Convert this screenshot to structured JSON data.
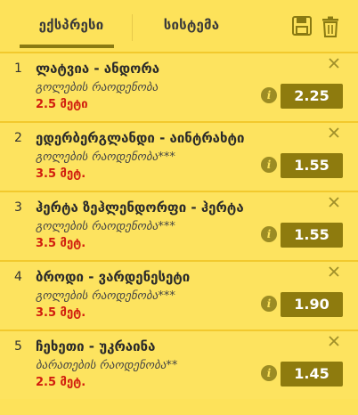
{
  "tabs": {
    "express": "ექსპრესი",
    "system": "სისტემა"
  },
  "icons": {
    "save": "floppy-disk-icon",
    "trash": "trash-icon",
    "close": "close-icon",
    "info": "info-icon"
  },
  "colors": {
    "background": "#fde25a",
    "odds_bg": "#8e7b0e",
    "pick_text": "#d11d0e",
    "tab_underline": "#8a7a12"
  },
  "bets": [
    {
      "num": "1",
      "match": "ლატვია - ანდორა",
      "market": "გოლების რაოდენობა",
      "pick": "2.5 მეტი",
      "odds": "2.25"
    },
    {
      "num": "2",
      "match": "ედერბერგლანდი - აინტრახტი",
      "market": "გოლების რაოდენობა***",
      "pick": "3.5 მეტ.",
      "odds": "1.55"
    },
    {
      "num": "3",
      "match": "ჰერტა ზეჰლენდორფი - ჰერტა",
      "market": "გოლების რაოდენობა***",
      "pick": "3.5 მეტ.",
      "odds": "1.55"
    },
    {
      "num": "4",
      "match": "ბროდი - ვარდენესეტი",
      "market": "გოლების რაოდენობა***",
      "pick": "3.5 მეტ.",
      "odds": "1.90"
    },
    {
      "num": "5",
      "match": "ჩეხეთი - უკრაინა",
      "market": "ბარათების რაოდენობა**",
      "pick": "2.5 მეტ.",
      "odds": "1.45"
    }
  ]
}
